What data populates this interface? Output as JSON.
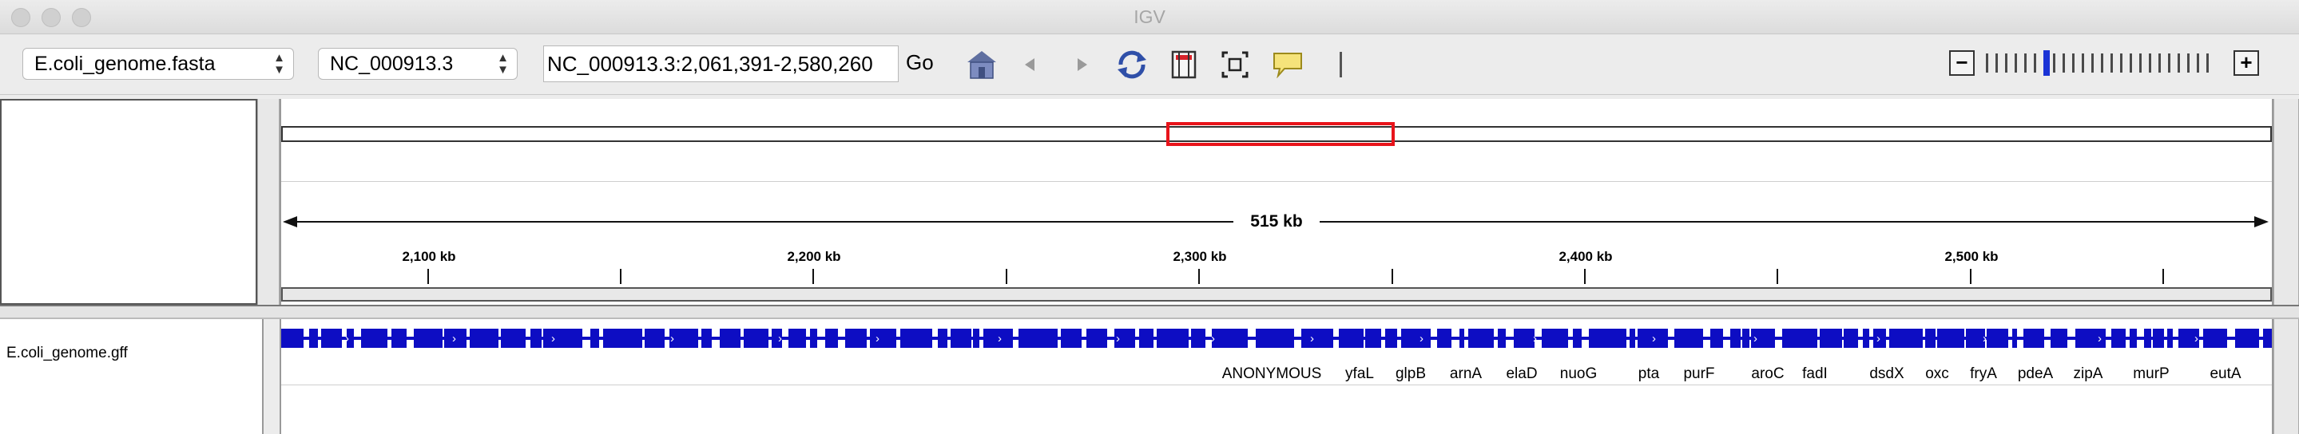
{
  "window": {
    "title": "IGV"
  },
  "toolbar": {
    "genome_select": "E.coli_genome.fasta",
    "chromosome_select": "NC_000913.3",
    "locus": "NC_000913.3:2,061,391-2,580,260",
    "go_label": "Go"
  },
  "ruler": {
    "span_label": "515 kb",
    "tick_labels": [
      "2,100 kb",
      "2,200 kb",
      "2,300 kb",
      "2,400 kb",
      "2,500 kb"
    ]
  },
  "tracks": {
    "gff_name": "E.coli_genome.gff",
    "feature_color": "#0d0dc3",
    "gene_labels": [
      "ANONYMOUS",
      "yfaL",
      "glpB",
      "arnA",
      "elaD",
      "nuoG",
      "pta",
      "purF",
      "aroC",
      "fadI",
      "dsdX",
      "oxc",
      "fryA",
      "pdeA",
      "zipA",
      "murP",
      "eutA"
    ]
  },
  "colors": {
    "region_box": "#e8141b",
    "accent": "#1a33d6"
  },
  "icons": [
    "home-icon",
    "back-icon",
    "forward-icon",
    "refresh-icon",
    "region-of-interest-icon",
    "fit-to-window-icon",
    "popup-info-icon"
  ]
}
